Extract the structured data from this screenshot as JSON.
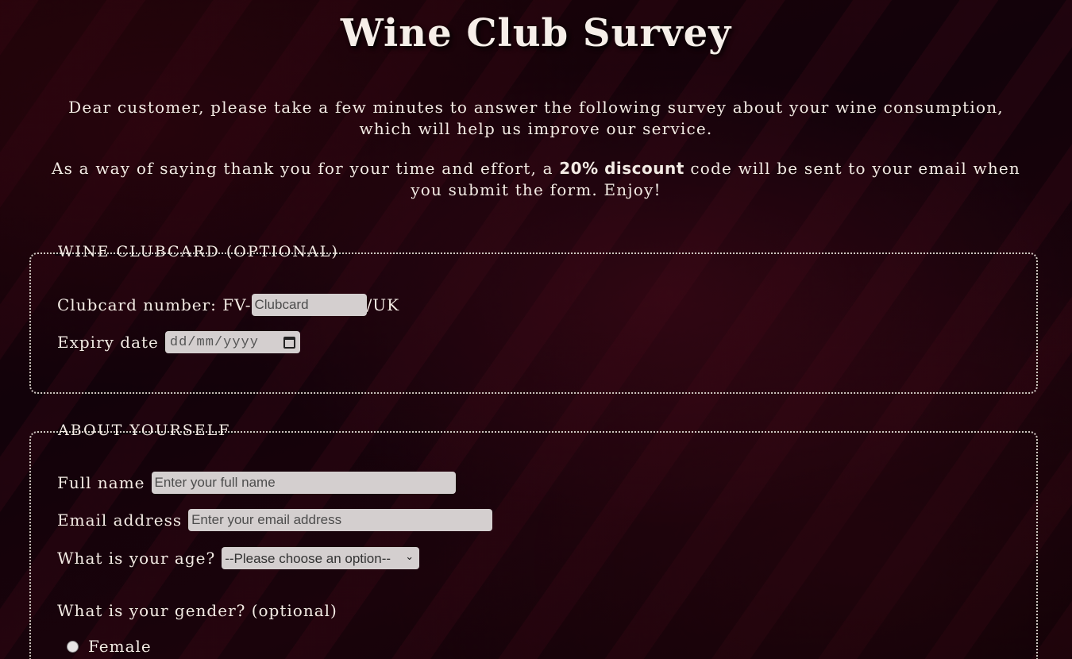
{
  "page": {
    "title": "Wine Club Survey",
    "intro_text": "Dear customer, please take a few minutes to answer the following survey about your wine consumption, which will help us improve our service.",
    "thanks_before": "As a way of saying thank you for your time and effort, a ",
    "thanks_bold": "20% discount",
    "thanks_after": " code will be sent to your email when you submit the form. Enjoy!"
  },
  "clubcard": {
    "legend": "WINE CLUBCARD (OPTIONAL)",
    "number_label": "Clubcard number: FV-",
    "number_placeholder": "Clubcard",
    "number_suffix": "/UK",
    "expiry_label": "Expiry date",
    "expiry_placeholder": "dd/mm/yyyy"
  },
  "about": {
    "legend": "ABOUT YOURSELF",
    "name_label": "Full name",
    "name_placeholder": "Enter your full name",
    "email_label": "Email address",
    "email_placeholder": "Enter your email address",
    "age_label": "What is your age?",
    "age_selected": "--Please choose an option--",
    "gender_label": "What is your gender? (optional)",
    "gender_options": [
      "Female"
    ]
  },
  "icons": {
    "calendar": "calendar-icon",
    "chevron": "chevron-down-icon"
  },
  "colors": {
    "input_bg": "#d4cfcf",
    "text": "#f3ebe4",
    "background": "#12020a"
  }
}
